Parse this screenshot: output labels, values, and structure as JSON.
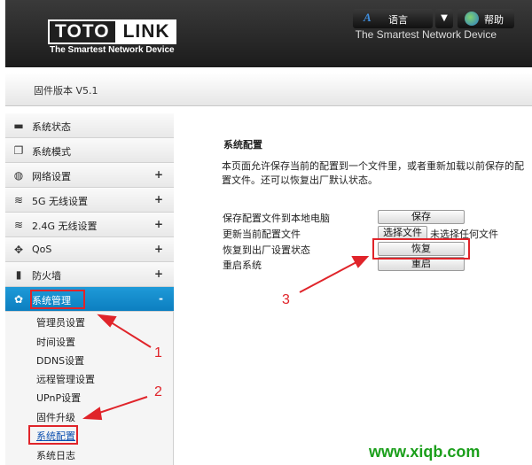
{
  "header": {
    "logo_left": "TOTO",
    "logo_right": "LINK",
    "logo_tagline": "The Smartest Network Device",
    "tagline": "The Smartest Network Device"
  },
  "toolbar": {
    "firmware": "固件版本 V5.1",
    "language_icon": "A",
    "language_label": "语言",
    "dropdown_icon": "▼",
    "help_label": "帮助"
  },
  "sidebar": {
    "items": [
      {
        "label": "系统状态",
        "icon": "status-icon",
        "glyph": "▬"
      },
      {
        "label": "系统模式",
        "icon": "mode-icon",
        "glyph": "❐"
      },
      {
        "label": "网络设置",
        "icon": "globe-icon",
        "glyph": "◍",
        "plus": "+"
      },
      {
        "label": "5G  无线设置",
        "icon": "wifi-icon",
        "glyph": "≋",
        "plus": "+"
      },
      {
        "label": "2.4G  无线设置",
        "icon": "wifi-icon",
        "glyph": "≋",
        "plus": "+"
      },
      {
        "label": "QoS",
        "icon": "qos-icon",
        "glyph": "✥",
        "plus": "+"
      },
      {
        "label": "防火墙",
        "icon": "lock-icon",
        "glyph": "▮",
        "plus": "+"
      },
      {
        "label": "系统管理",
        "icon": "gear-icon",
        "glyph": "✿",
        "plus": "-"
      }
    ],
    "sub_items": [
      "管理员设置",
      "时间设置",
      "DDNS设置",
      "远程管理设置",
      "UPnP设置",
      "固件升级",
      "系统配置",
      "系统日志"
    ]
  },
  "main": {
    "title": "系统配置",
    "description": "本页面允许保存当前的配置到一个文件里，或者重新加载以前保存的配置文件。还可以恢复出厂默认状态。",
    "rows": [
      {
        "label": "保存配置文件到本地电脑",
        "button": "保存"
      },
      {
        "label": "更新当前配置文件",
        "button": "选择文件",
        "status": "未选择任何文件"
      },
      {
        "label": "恢复到出厂设置状态",
        "button": "恢复"
      },
      {
        "label": "重启系统",
        "button": "重启"
      }
    ]
  },
  "annotations": {
    "numbers": [
      "1",
      "2",
      "3"
    ],
    "accent_color": "#e0242a"
  },
  "watermark": "www.xiqb.com"
}
